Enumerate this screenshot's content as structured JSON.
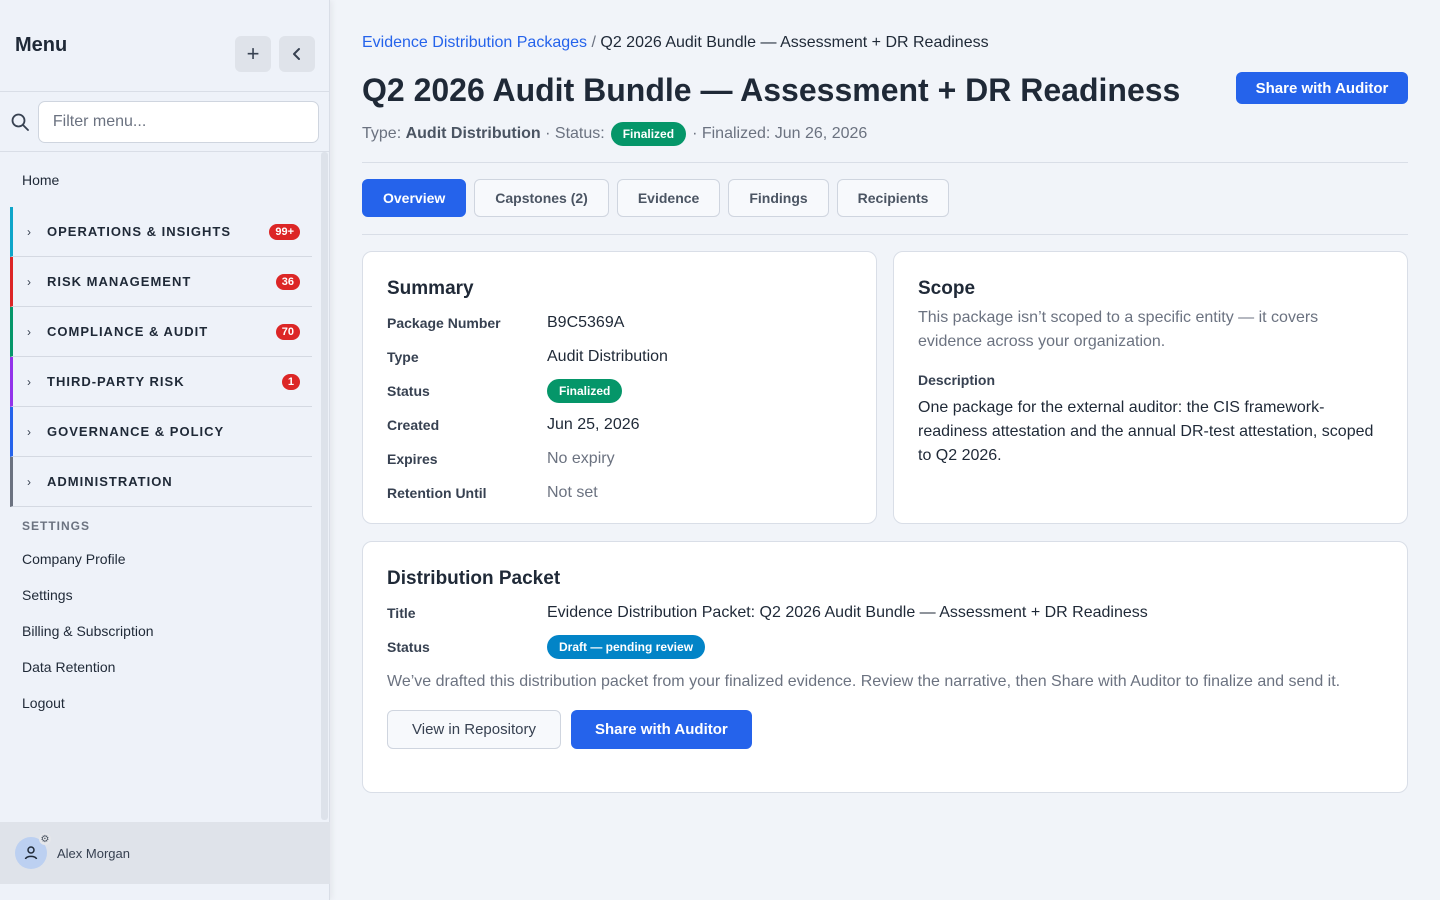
{
  "sidebar": {
    "title": "Menu",
    "search_placeholder": "Filter menu...",
    "home": "Home",
    "groups": [
      {
        "label": "OPERATIONS & INSIGHTS",
        "badge": "99+",
        "color": "#0ea5c9"
      },
      {
        "label": "RISK MANAGEMENT",
        "badge": "36",
        "color": "#dc2626"
      },
      {
        "label": "COMPLIANCE & AUDIT",
        "badge": "70",
        "color": "#059669"
      },
      {
        "label": "THIRD-PARTY RISK",
        "badge": "1",
        "color": "#9333ea"
      },
      {
        "label": "GOVERNANCE & POLICY",
        "badge": "",
        "color": "#2563eb"
      },
      {
        "label": "ADMINISTRATION",
        "badge": "",
        "color": "#6b7280"
      }
    ],
    "settings_header": "SETTINGS",
    "settings_links": [
      "Company Profile",
      "Settings",
      "Billing & Subscription",
      "Data Retention",
      "Logout"
    ],
    "user": "Alex Morgan"
  },
  "breadcrumb": {
    "parent": "Evidence Distribution Packages",
    "separator": "/",
    "current": "Q2 2026 Audit Bundle — Assessment + DR Readiness"
  },
  "page": {
    "title": "Q2 2026 Audit Bundle — Assessment + DR Readiness",
    "share_button": "Share with Auditor",
    "meta": {
      "type_label": "Type:",
      "type_value": "Audit Distribution",
      "status_label": "· Status:",
      "status_value": "Finalized",
      "finalized": "· Finalized: Jun 26, 2026"
    }
  },
  "tabs": [
    "Overview",
    "Capstones (2)",
    "Evidence",
    "Findings",
    "Recipients"
  ],
  "summary": {
    "title": "Summary",
    "rows": [
      {
        "key": "Package Number",
        "value": "B9C5369A"
      },
      {
        "key": "Type",
        "value": "Audit Distribution"
      },
      {
        "key": "Status",
        "value": "Finalized"
      },
      {
        "key": "Created",
        "value": "Jun 25, 2026"
      },
      {
        "key": "Expires",
        "value": "No expiry"
      },
      {
        "key": "Retention Until",
        "value": "Not set"
      }
    ]
  },
  "scope": {
    "title": "Scope",
    "text": "This package isn’t scoped to a specific entity — it covers evidence across your organization.",
    "description_label": "Description",
    "description": "One package for the external auditor: the CIS framework-readiness attestation and the annual DR-test attestation, scoped to Q2 2026."
  },
  "packet": {
    "title": "Distribution Packet",
    "title_label": "Title",
    "title_value": "Evidence Distribution Packet: Q2 2026 Audit Bundle — Assessment + DR Readiness",
    "status_label": "Status",
    "status_value": "Draft — pending review",
    "note": "We’ve drafted this distribution packet from your finalized evidence. Review the narrative, then Share with Auditor to finalize and send it.",
    "view_button": "View in Repository",
    "share_button": "Share with Auditor"
  }
}
